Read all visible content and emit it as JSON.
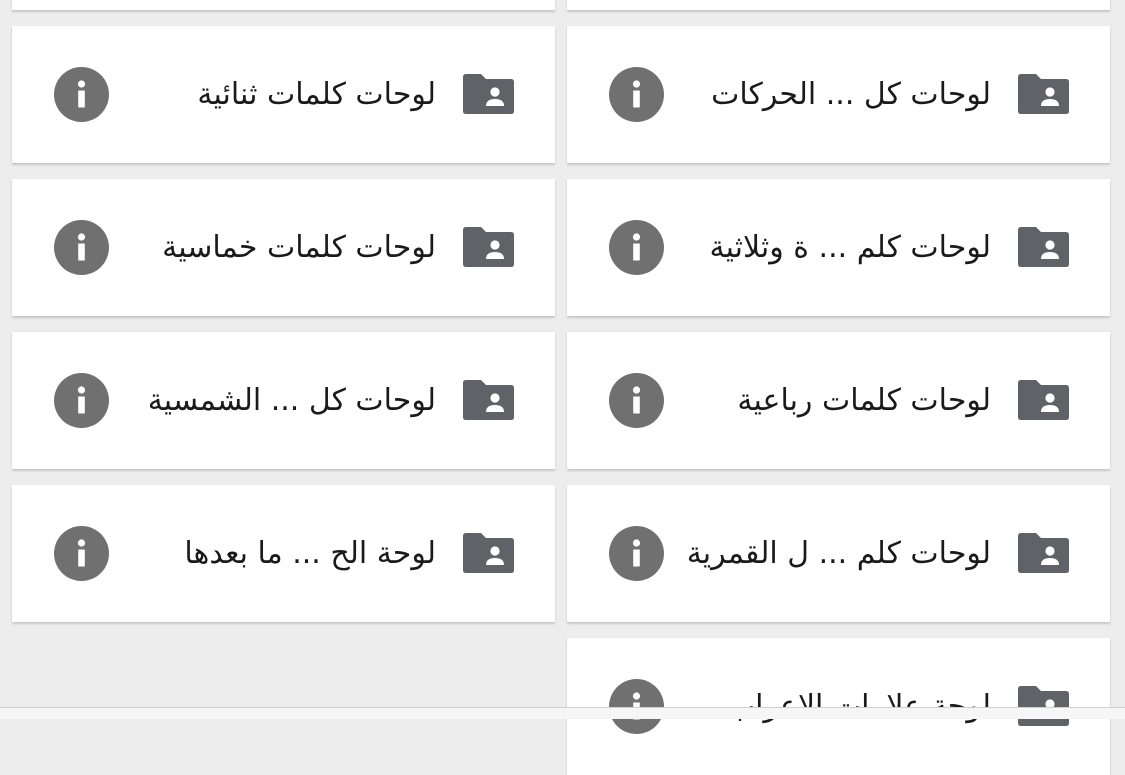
{
  "colors": {
    "background": "#ededed",
    "card": "#ffffff",
    "icon": "#5f6368",
    "info_icon": "#707070",
    "text": "#1a1a1a"
  },
  "icons": {
    "folder": "folder-shared-icon",
    "info": "info-icon"
  },
  "cards": [
    {
      "title": "لوحات كل ... الحركات"
    },
    {
      "title": "لوحات كلمات ثنائية"
    },
    {
      "title": "لوحات كلم ... ة وثلاثية"
    },
    {
      "title": "لوحات كلمات خماسية"
    },
    {
      "title": "لوحات كلمات رباعية"
    },
    {
      "title": "لوحات كل ... الشمسية"
    },
    {
      "title": "لوحات كلم ... ل القمرية"
    },
    {
      "title": "لوحة الح ... ما بعدها"
    },
    {
      "title": "لوحة علامات الاعراب"
    }
  ]
}
